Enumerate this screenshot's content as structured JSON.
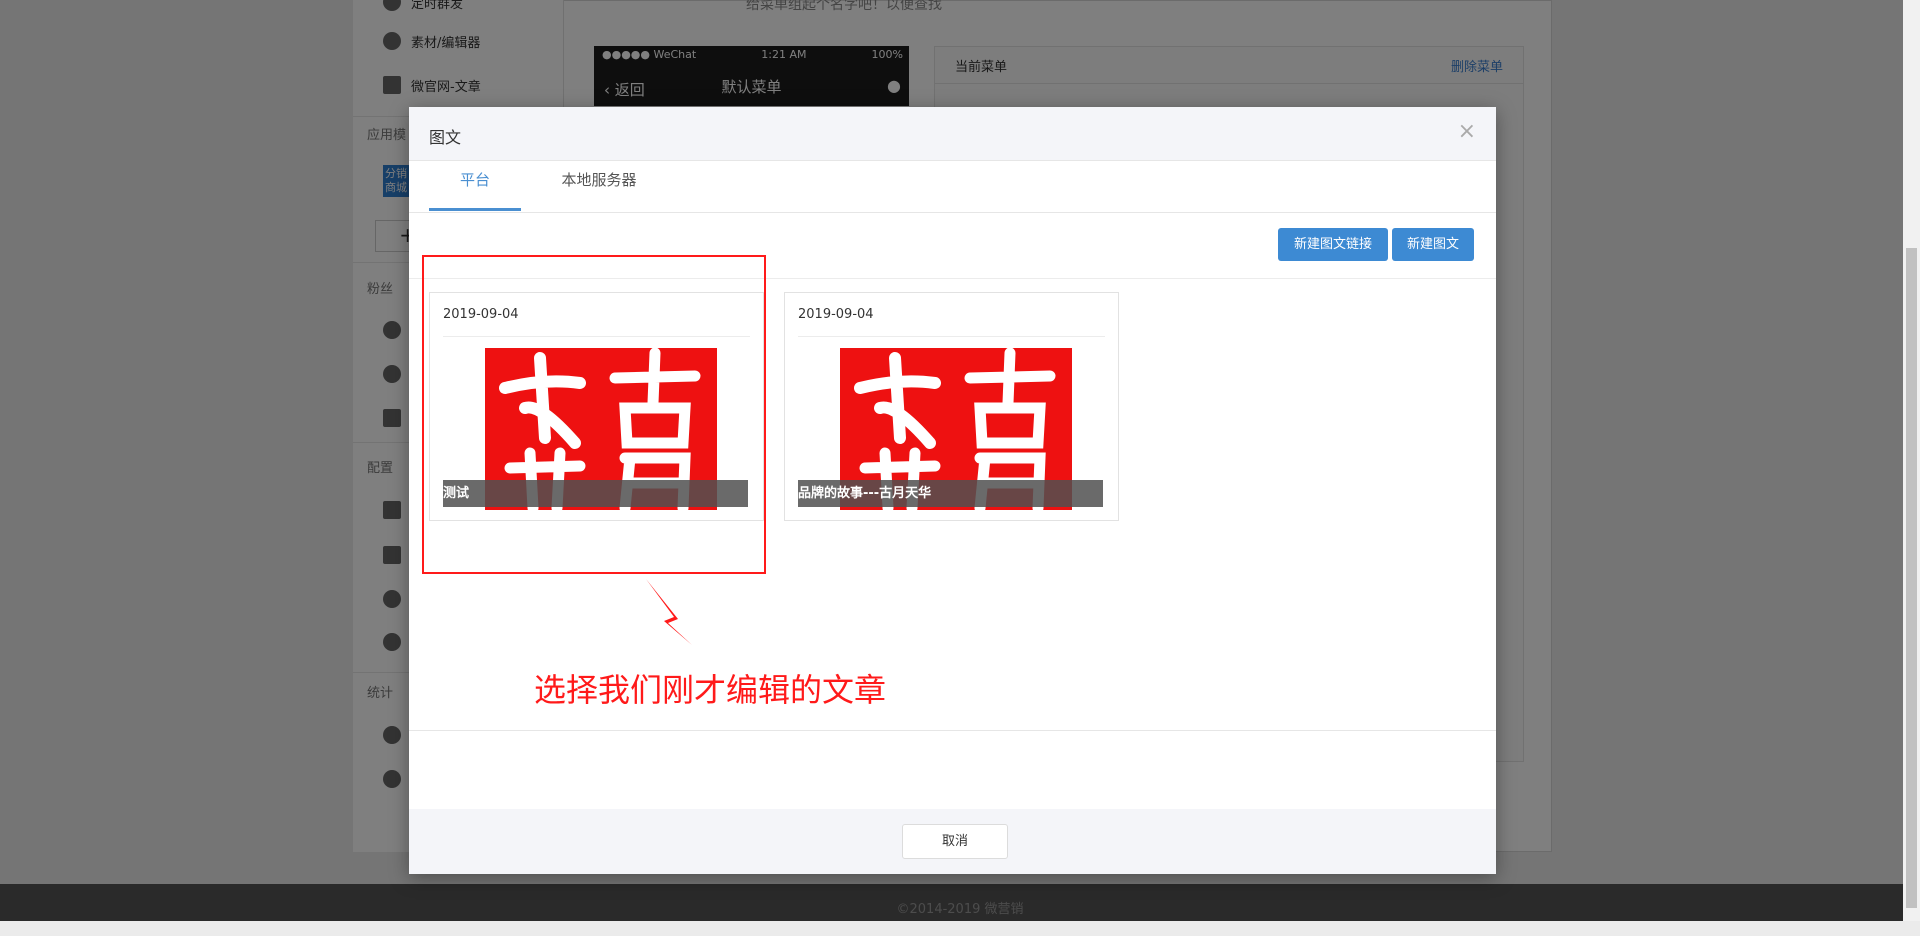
{
  "background": {
    "hint": "给菜单组起个名字吧！以便查找",
    "sidebar": {
      "top_item": "定时群发",
      "items": [
        {
          "label": "素材/编辑器",
          "icon": "edit-icon"
        },
        {
          "label": "微官网-文章",
          "icon": "home-icon"
        }
      ],
      "section_apps": "应用模",
      "badge_text": "分销商城",
      "section_fans": "粉丝",
      "section_config": "配置",
      "section_stats": "统计"
    },
    "phone": {
      "carrier": "●●●●● WeChat",
      "time": "1:21 AM",
      "battery": "100%",
      "back": "返回",
      "title": "默认菜单"
    },
    "menu_panel": {
      "title": "当前菜单",
      "delete": "删除菜单"
    },
    "footer": "©2014-2019 微营销"
  },
  "modal": {
    "title": "图文",
    "close": "×",
    "tabs": [
      {
        "label": "平台",
        "active": true
      },
      {
        "label": "本地服务器",
        "active": false
      }
    ],
    "buttons": {
      "new_link": "新建图文链接",
      "new_article": "新建图文"
    },
    "cards": [
      {
        "date": "2019-09-04",
        "caption": "测试"
      },
      {
        "date": "2019-09-04",
        "caption": "品牌的故事---古月天华"
      }
    ],
    "annotation": "选择我们刚才编辑的文章",
    "cancel": "取消"
  },
  "colors": {
    "accent": "#3d8ad3",
    "highlight": "#ff1a1a"
  }
}
